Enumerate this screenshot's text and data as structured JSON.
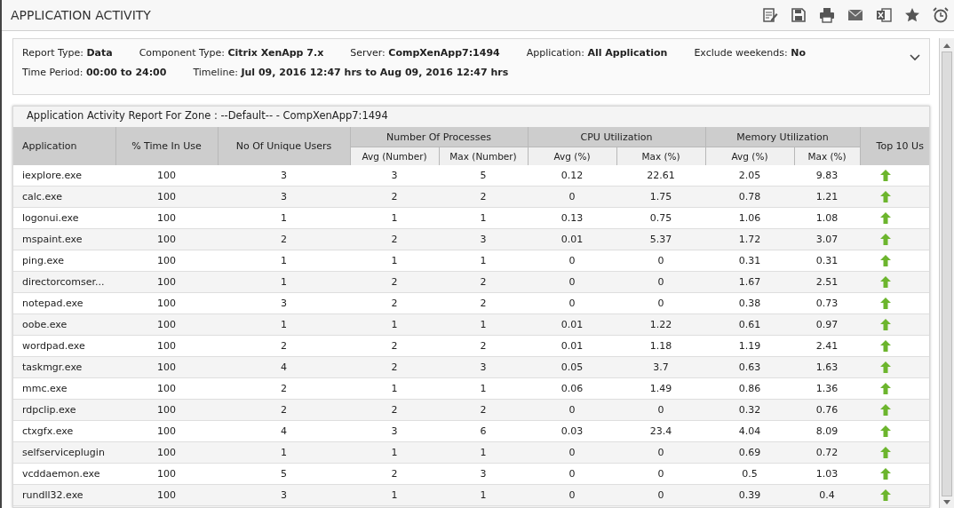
{
  "header": {
    "title": "APPLICATION ACTIVITY"
  },
  "filters": {
    "expanded": false,
    "lines": [
      [
        "Report Type: **Data**",
        "Component Type: **Citrix XenApp 7.x**",
        "Server: **CompXenApp7:1494**",
        "Application: **All Application**",
        "Exclude weekends: **No**"
      ],
      [
        "Time Period: **00:00 to 24:00**",
        "Timeline: **Jul 09, 2016 12:47 hrs to Aug 09, 2016 12:47 hrs**"
      ]
    ]
  },
  "report": {
    "title": "Application Activity Report For Zone : --Default-- - CompXenApp7:1494",
    "columns": [
      "Application",
      "% Time In Use",
      "No Of Unique Users"
    ],
    "groups": [
      {
        "label": "Number Of Processes",
        "sub": [
          "Avg (Number)",
          "Max (Number)"
        ]
      },
      {
        "label": "CPU Utilization",
        "sub": [
          "Avg (%)",
          "Max (%)"
        ]
      },
      {
        "label": "Memory Utilization",
        "sub": [
          "Avg (%)",
          "Max (%)"
        ]
      }
    ],
    "last_column": "Top 10 Us",
    "rows": [
      {
        "cells": [
          "iexplore.exe",
          "100",
          "3",
          "3",
          "5",
          "0.12",
          "22.61",
          "2.05",
          "9.83"
        ]
      },
      {
        "cells": [
          "calc.exe",
          "100",
          "3",
          "2",
          "2",
          "0",
          "1.75",
          "0.78",
          "1.21"
        ]
      },
      {
        "cells": [
          "logonui.exe",
          "100",
          "1",
          "1",
          "1",
          "0.13",
          "0.75",
          "1.06",
          "1.08"
        ]
      },
      {
        "cells": [
          "mspaint.exe",
          "100",
          "2",
          "2",
          "3",
          "0.01",
          "5.37",
          "1.72",
          "3.07"
        ]
      },
      {
        "cells": [
          "ping.exe",
          "100",
          "1",
          "1",
          "1",
          "0",
          "0",
          "0.31",
          "0.31"
        ]
      },
      {
        "cells": [
          "directorcomser...",
          "100",
          "1",
          "2",
          "2",
          "0",
          "0",
          "1.67",
          "2.51"
        ]
      },
      {
        "cells": [
          "notepad.exe",
          "100",
          "3",
          "2",
          "2",
          "0",
          "0",
          "0.38",
          "0.73"
        ]
      },
      {
        "cells": [
          "oobe.exe",
          "100",
          "1",
          "1",
          "1",
          "0.01",
          "1.22",
          "0.61",
          "0.97"
        ]
      },
      {
        "cells": [
          "wordpad.exe",
          "100",
          "2",
          "2",
          "2",
          "0.01",
          "1.18",
          "1.19",
          "2.41"
        ]
      },
      {
        "cells": [
          "taskmgr.exe",
          "100",
          "4",
          "2",
          "3",
          "0.05",
          "3.7",
          "0.63",
          "1.63"
        ]
      },
      {
        "cells": [
          "mmc.exe",
          "100",
          "2",
          "1",
          "1",
          "0.06",
          "1.49",
          "0.86",
          "1.36"
        ]
      },
      {
        "cells": [
          "rdpclip.exe",
          "100",
          "2",
          "2",
          "2",
          "0",
          "0",
          "0.32",
          "0.76"
        ]
      },
      {
        "cells": [
          "ctxgfx.exe",
          "100",
          "4",
          "3",
          "6",
          "0.03",
          "23.4",
          "4.04",
          "8.09"
        ]
      },
      {
        "cells": [
          "selfserviceplugin",
          "100",
          "1",
          "1",
          "1",
          "0",
          "0",
          "0.69",
          "0.72"
        ]
      },
      {
        "cells": [
          "vcddaemon.exe",
          "100",
          "5",
          "2",
          "3",
          "0",
          "0",
          "0.5",
          "1.03"
        ]
      },
      {
        "cells": [
          "rundll32.exe",
          "100",
          "3",
          "1",
          "1",
          "0",
          "0",
          "0.39",
          "0.4"
        ]
      }
    ]
  }
}
